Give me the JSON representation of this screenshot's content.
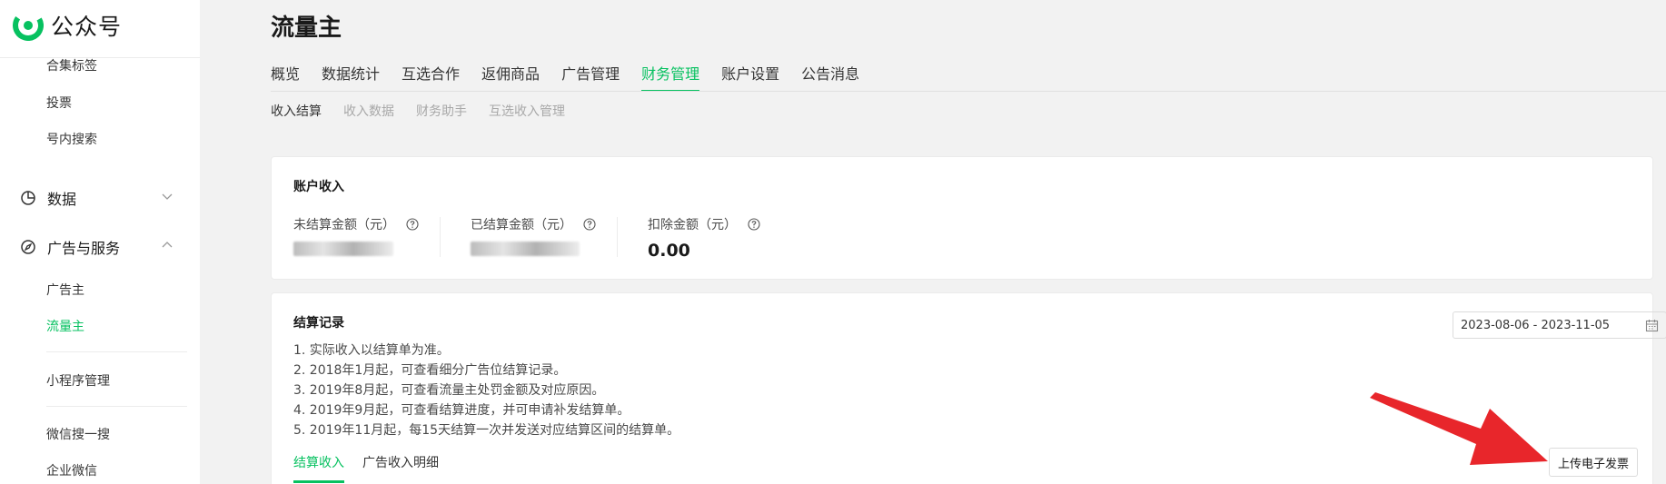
{
  "brand": {
    "name": "公众号",
    "accent": "#07c160"
  },
  "sidebar": {
    "items_top": [
      {
        "label": "合集标签"
      },
      {
        "label": "投票"
      },
      {
        "label": "号内搜索"
      }
    ],
    "groups": [
      {
        "label": "数据",
        "icon": "pie-chart-icon",
        "chevron": "chevron-down-icon"
      },
      {
        "label": "广告与服务",
        "icon": "compass-icon",
        "chevron": "chevron-up-icon"
      }
    ],
    "ad_items": [
      {
        "label": "广告主"
      },
      {
        "label": "流量主",
        "active": true
      }
    ],
    "items_bottom": [
      {
        "label": "小程序管理"
      },
      {
        "label": "微信搜一搜"
      },
      {
        "label": "企业微信"
      }
    ]
  },
  "page": {
    "title": "流量主"
  },
  "tabs": [
    {
      "label": "概览"
    },
    {
      "label": "数据统计"
    },
    {
      "label": "互选合作"
    },
    {
      "label": "返佣商品"
    },
    {
      "label": "广告管理"
    },
    {
      "label": "财务管理",
      "active": true
    },
    {
      "label": "账户设置"
    },
    {
      "label": "公告消息"
    }
  ],
  "subtabs": [
    {
      "label": "收入结算",
      "active": true
    },
    {
      "label": "收入数据"
    },
    {
      "label": "财务助手"
    },
    {
      "label": "互选收入管理"
    }
  ],
  "income": {
    "title": "账户收入",
    "stats": [
      {
        "label": "未结算金额（元）",
        "value": "",
        "redacted": true
      },
      {
        "label": "已结算金额（元）",
        "value": "",
        "redacted": true
      },
      {
        "label": "扣除金额（元）",
        "value": "0.00"
      }
    ]
  },
  "records": {
    "title": "结算记录",
    "date_range": "2023-08-06 - 2023-11-05",
    "notes": [
      "1. 实际收入以结算单为准。",
      "2. 2018年1月起，可查看细分广告位结算记录。",
      "3. 2019年8月起，可查看流量主处罚金额及对应原因。",
      "4. 2019年9月起，可查看结算进度，并可申请补发结算单。",
      "5. 2019年11月起，每15天结算一次并发送对应结算区间的结算单。"
    ],
    "tabs": [
      {
        "label": "结算收入",
        "active": true
      },
      {
        "label": "广告收入明细"
      }
    ],
    "upload_button": "上传电子发票"
  },
  "annotation": {
    "arrow_color": "#e8262b"
  }
}
